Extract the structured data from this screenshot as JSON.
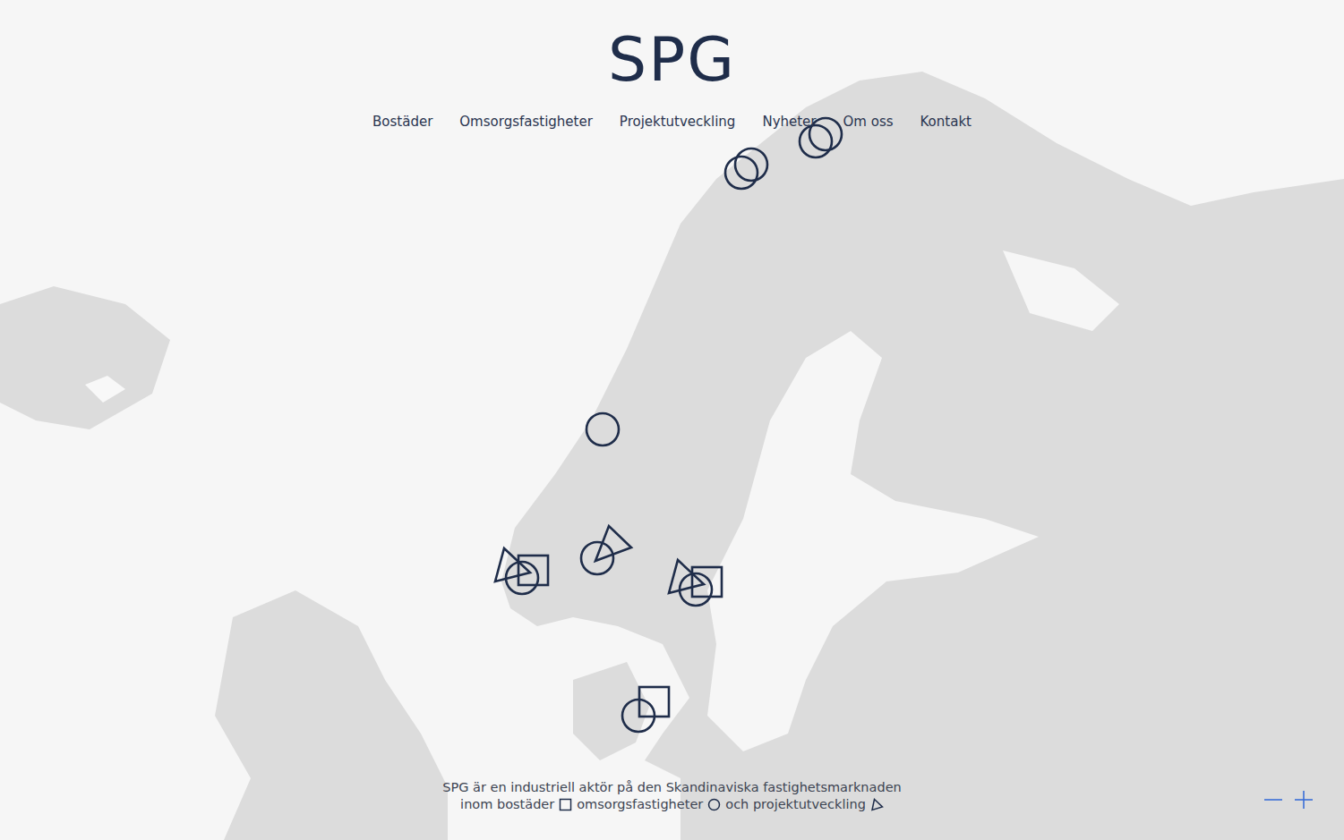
{
  "logo": "SPG",
  "nav": [
    {
      "label": "Bostäder",
      "selected": false
    },
    {
      "label": "Omsorgsfastigheter",
      "selected": false
    },
    {
      "label": "Projektutveckling",
      "selected": false
    },
    {
      "label": "Nyheter",
      "selected": false
    },
    {
      "label": "Om oss",
      "selected": false
    },
    {
      "label": "Kontakt",
      "selected": false
    }
  ],
  "markers": [
    {
      "shapes": [
        {
          "kind": "circle"
        },
        {
          "kind": "circle"
        }
      ]
    },
    {
      "shapes": [
        {
          "kind": "circle"
        },
        {
          "kind": "circle"
        }
      ]
    },
    {
      "shapes": [
        {
          "kind": "circle"
        }
      ]
    },
    {
      "shapes": [
        {
          "kind": "triangle"
        },
        {
          "kind": "square"
        },
        {
          "kind": "circle"
        }
      ]
    },
    {
      "shapes": [
        {
          "kind": "circle"
        },
        {
          "kind": "triangle"
        }
      ]
    },
    {
      "shapes": [
        {
          "kind": "triangle"
        },
        {
          "kind": "square"
        },
        {
          "kind": "circle"
        }
      ]
    },
    {
      "shapes": [
        {
          "kind": "square"
        },
        {
          "kind": "circle"
        }
      ]
    }
  ],
  "caption": [
    {
      "parts": [
        {
          "kind": "text",
          "text": "SPG är en industriell aktör på den Skandinaviska fastighetsmarknaden"
        }
      ]
    },
    {
      "parts": [
        {
          "kind": "text",
          "text": "inom bostäder"
        },
        {
          "kind": "square"
        },
        {
          "kind": "text",
          "text": "omsorgsfastigheter"
        },
        {
          "kind": "circle"
        },
        {
          "kind": "text",
          "text": "och projektutveckling"
        },
        {
          "kind": "triangle"
        }
      ]
    }
  ]
}
